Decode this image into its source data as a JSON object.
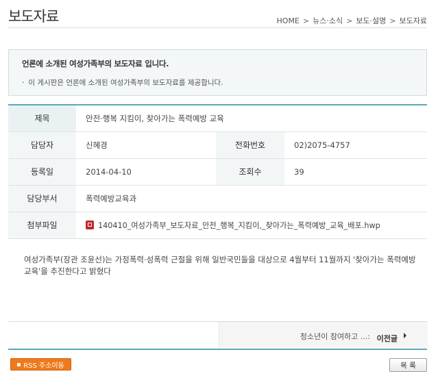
{
  "page": {
    "title": "보도자료"
  },
  "breadcrumb": {
    "items": [
      "HOME",
      "뉴스·소식",
      "보도·설명",
      "보도자료"
    ],
    "separator": ">"
  },
  "notice": {
    "heading": "언론에 소개된 여성가족부의 보도자료 입니다.",
    "bullet": "·",
    "body": "이 게시판은 언론에 소개된 여성가족부의 보도자료를 제공합니다."
  },
  "info": {
    "title_label": "제목",
    "title_value": "안전·행복 지킴이, 찾아가는 폭력예방 교육",
    "manager_label": "담당자",
    "manager_value": "신혜경",
    "phone_label": "전화번호",
    "phone_value": "02)2075-4757",
    "date_label": "등록일",
    "date_value": "2014-04-10",
    "views_label": "조회수",
    "views_value": "39",
    "dept_label": "담당부서",
    "dept_value": "폭력예방교육과",
    "attach_label": "첨부파일",
    "attach_value": "140410_여성가족부_보도자료_안전_행복_지킴이,_찾아가는_폭력예방_교육_배포.hwp",
    "attach_icon": "hwp-file-icon"
  },
  "content": {
    "text": "여성가족부(장관 조윤선)는 가정폭력·성폭력 근절을 위해 일반국민들을 대상으로 4월부터 11월까지 '찾아가는 폭력예방교육'을 추진한다고 밝혔다"
  },
  "navigation": {
    "prev_title": "청소년이 참여하고 ...:",
    "prev_label": "이전글"
  },
  "buttons": {
    "rss_label": "RSS 주소이동",
    "list_label": "목 록"
  },
  "colors": {
    "accent": "#5aa7ba",
    "rss": "#ef7a1c"
  }
}
